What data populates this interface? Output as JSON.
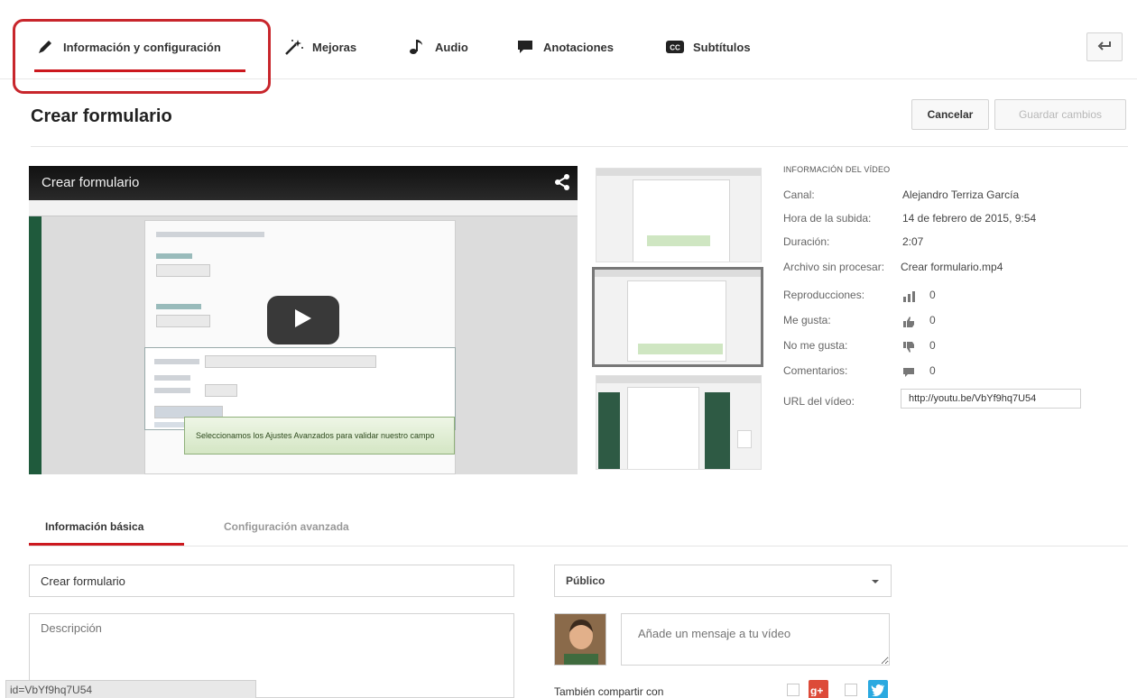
{
  "tabs": {
    "info": "Información y configuración",
    "enhancements": "Mejoras",
    "audio": "Audio",
    "annotations": "Anotaciones",
    "subtitles": "Subtítulos"
  },
  "header": {
    "title": "Crear formulario",
    "cancel_label": "Cancelar",
    "save_label": "Guardar cambios"
  },
  "player": {
    "title": "Crear formulario",
    "tooltip": "Seleccionamos los Ajustes Avanzados para validar nuestro campo"
  },
  "video_info": {
    "heading": "INFORMACIÓN DEL VÍDEO",
    "channel_label": "Canal:",
    "channel_value": "Alejandro Terriza García",
    "upload_label": "Hora de la subida:",
    "upload_value": "14 de febrero de 2015, 9:54",
    "duration_label": "Duración:",
    "duration_value": "2:07",
    "raw_file_label": "Archivo sin procesar:",
    "raw_file_value": "Crear formulario.mp4",
    "views_label": "Reproducciones:",
    "views_value": "0",
    "likes_label": "Me gusta:",
    "likes_value": "0",
    "dislikes_label": "No me gusta:",
    "dislikes_value": "0",
    "comments_label": "Comentarios:",
    "comments_value": "0",
    "url_label": "URL del vídeo:",
    "url_value": "http://youtu.be/VbYf9hq7U54"
  },
  "subtabs": {
    "basic": "Información básica",
    "advanced": "Configuración avanzada"
  },
  "form": {
    "title_value": "Crear formulario",
    "description_placeholder": "Descripción",
    "privacy_value": "Público",
    "message_placeholder": "Añade un mensaje a tu vídeo",
    "share_label": "También compartir con"
  },
  "status_bar": "id=VbYf9hq7U54",
  "colors": {
    "accent_red": "#cc181e",
    "google_plus": "#dd4b39",
    "twitter": "#2aa9e0"
  }
}
